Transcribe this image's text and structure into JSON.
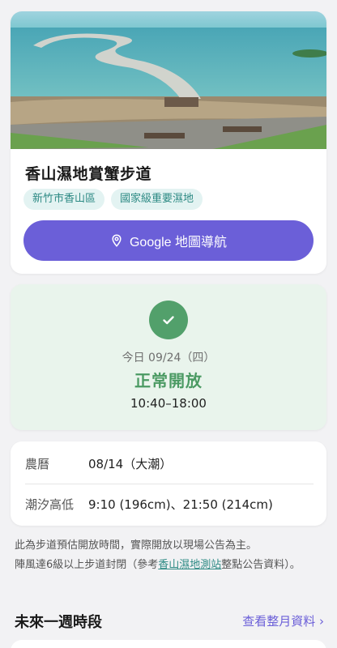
{
  "hero": {
    "title": "香山濕地賞蟹步道",
    "tags": [
      "新竹市香山區",
      "國家級重要濕地"
    ],
    "nav_button_label": "Google 地圖導航",
    "nav_icon": "map-pin-icon"
  },
  "status": {
    "icon": "check-icon",
    "date": "今日 09/24（四）",
    "label": "正常開放",
    "hours": "10:40–18:00"
  },
  "info": {
    "rows": [
      {
        "label": "農曆",
        "value": "08/14（大潮）"
      },
      {
        "label": "潮汐高低",
        "value": "9:10 (196cm)、21:50 (214cm)"
      }
    ]
  },
  "notice": {
    "line1": "此為步道預估開放時間，實際開放以現場公告為主。",
    "line2_prefix": "陣風達6級以上步道封閉（參考",
    "link_text": "香山濕地測站",
    "line2_suffix": "整點公告資料）。"
  },
  "week": {
    "title": "未來一週時段",
    "month_link": "查看整月資料 ›"
  },
  "colors": {
    "accent": "#6b5fd8",
    "status_bg": "#e9f4ec",
    "status_green": "#52a06b",
    "tag_bg": "#e3f3f2",
    "tag_text": "#2d8a84"
  }
}
